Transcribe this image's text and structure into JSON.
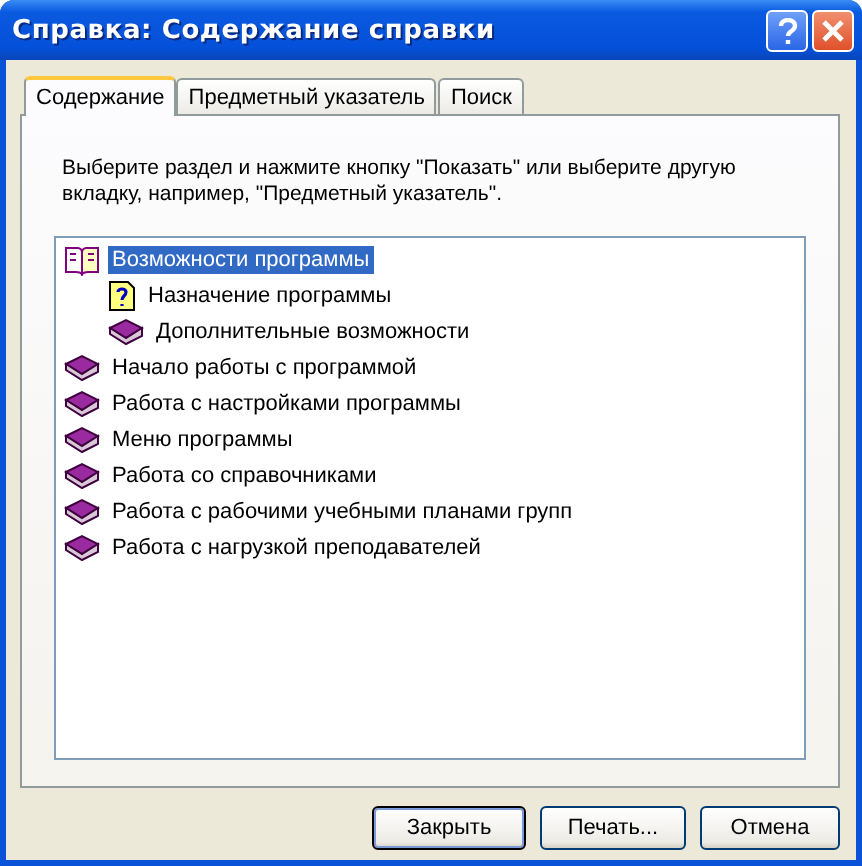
{
  "window": {
    "title": "Справка: Содержание справки"
  },
  "tabs": [
    {
      "label": "Содержание",
      "selected": true
    },
    {
      "label": "Предметный указатель",
      "selected": false
    },
    {
      "label": "Поиск",
      "selected": false
    }
  ],
  "instruction": "Выберите раздел и нажмите кнопку \"Показать\" или выберите другую вкладку, например, \"Предметный указатель\".",
  "tree": [
    {
      "kind": "book",
      "label": "Возможности программы",
      "selected": true,
      "expanded": true,
      "children": [
        {
          "kind": "topic",
          "label": "Назначение программы",
          "selected": false
        },
        {
          "kind": "book",
          "label": "Дополнительные возможности",
          "selected": false,
          "expanded": false
        }
      ]
    },
    {
      "kind": "book",
      "label": "Начало работы с программой",
      "selected": false,
      "expanded": false
    },
    {
      "kind": "book",
      "label": "Работа с настройками программы",
      "selected": false,
      "expanded": false
    },
    {
      "kind": "book",
      "label": "Меню программы",
      "selected": false,
      "expanded": false
    },
    {
      "kind": "book",
      "label": "Работа со справочниками",
      "selected": false,
      "expanded": false
    },
    {
      "kind": "book",
      "label": "Работа с рабочими учебными планами групп",
      "selected": false,
      "expanded": false
    },
    {
      "kind": "book",
      "label": "Работа с нагрузкой преподавателей",
      "selected": false,
      "expanded": false
    }
  ],
  "buttons": [
    {
      "label": "Закрыть",
      "default": true
    },
    {
      "label": "Печать...",
      "default": false
    },
    {
      "label": "Отмена",
      "default": false
    }
  ]
}
